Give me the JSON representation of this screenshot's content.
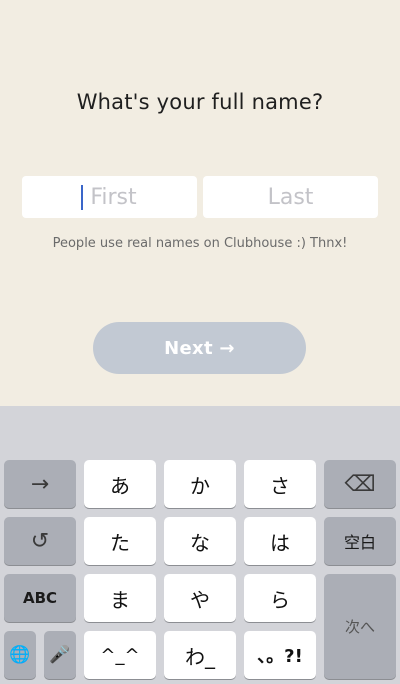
{
  "screen": {
    "title": "What's your full name?",
    "first_placeholder": "First",
    "last_placeholder": "Last",
    "hint": "People use real names on Clubhouse :) Thnx!",
    "next_label": "Next →"
  },
  "keyboard": {
    "tab_key": "→",
    "delete_key": "⌫",
    "undo_key": "↺",
    "space_key": "空白",
    "abc_key": "ABC",
    "next_key": "次へ",
    "globe_key": "🌐",
    "mic_key": "🎤",
    "keys": {
      "a": "あ",
      "ka": "か",
      "sa": "さ",
      "ta": "た",
      "na": "な",
      "ha": "は",
      "ma": "ま",
      "ya": "や",
      "ra": "ら",
      "emoticon": "^_^",
      "wa": "わ_",
      "punct": "、。?!"
    }
  },
  "colors": {
    "background": "#f2ede2",
    "next_button": "#c2c9d3",
    "caret": "#3a66c9",
    "keyboard": "#d3d4d9"
  }
}
